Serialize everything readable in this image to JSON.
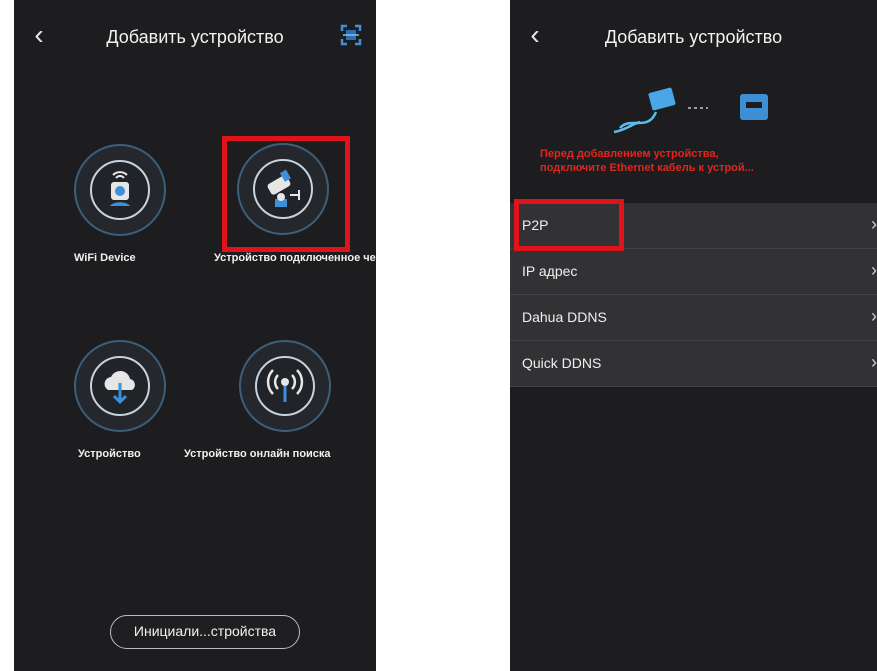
{
  "colors": {
    "background": "#1d1d1f",
    "accent_ring": "#3d5f7a",
    "highlight": "#e0121b",
    "warning": "#e0261f"
  },
  "left": {
    "title": "Добавить устройство",
    "tiles": [
      {
        "label": "WiFi Device",
        "icon": "wifi-camera-icon"
      },
      {
        "label": "Устройство подключенное через пр",
        "icon": "wired-camera-icon"
      },
      {
        "label": "Устройство",
        "icon": "cloud-download-icon"
      },
      {
        "label": "Устройство онлайн поиска",
        "icon": "broadcast-icon"
      }
    ],
    "init_button": "Инициали...стройства"
  },
  "right": {
    "title": "Добавить устройство",
    "warning_line1": "Перед добавлением устройства,",
    "warning_line2": "подключите Ethernet кабель к устрой...",
    "items": [
      {
        "label": "P2P"
      },
      {
        "label": "IP адрес"
      },
      {
        "label": "Dahua DDNS"
      },
      {
        "label": "Quick DDNS"
      }
    ]
  }
}
